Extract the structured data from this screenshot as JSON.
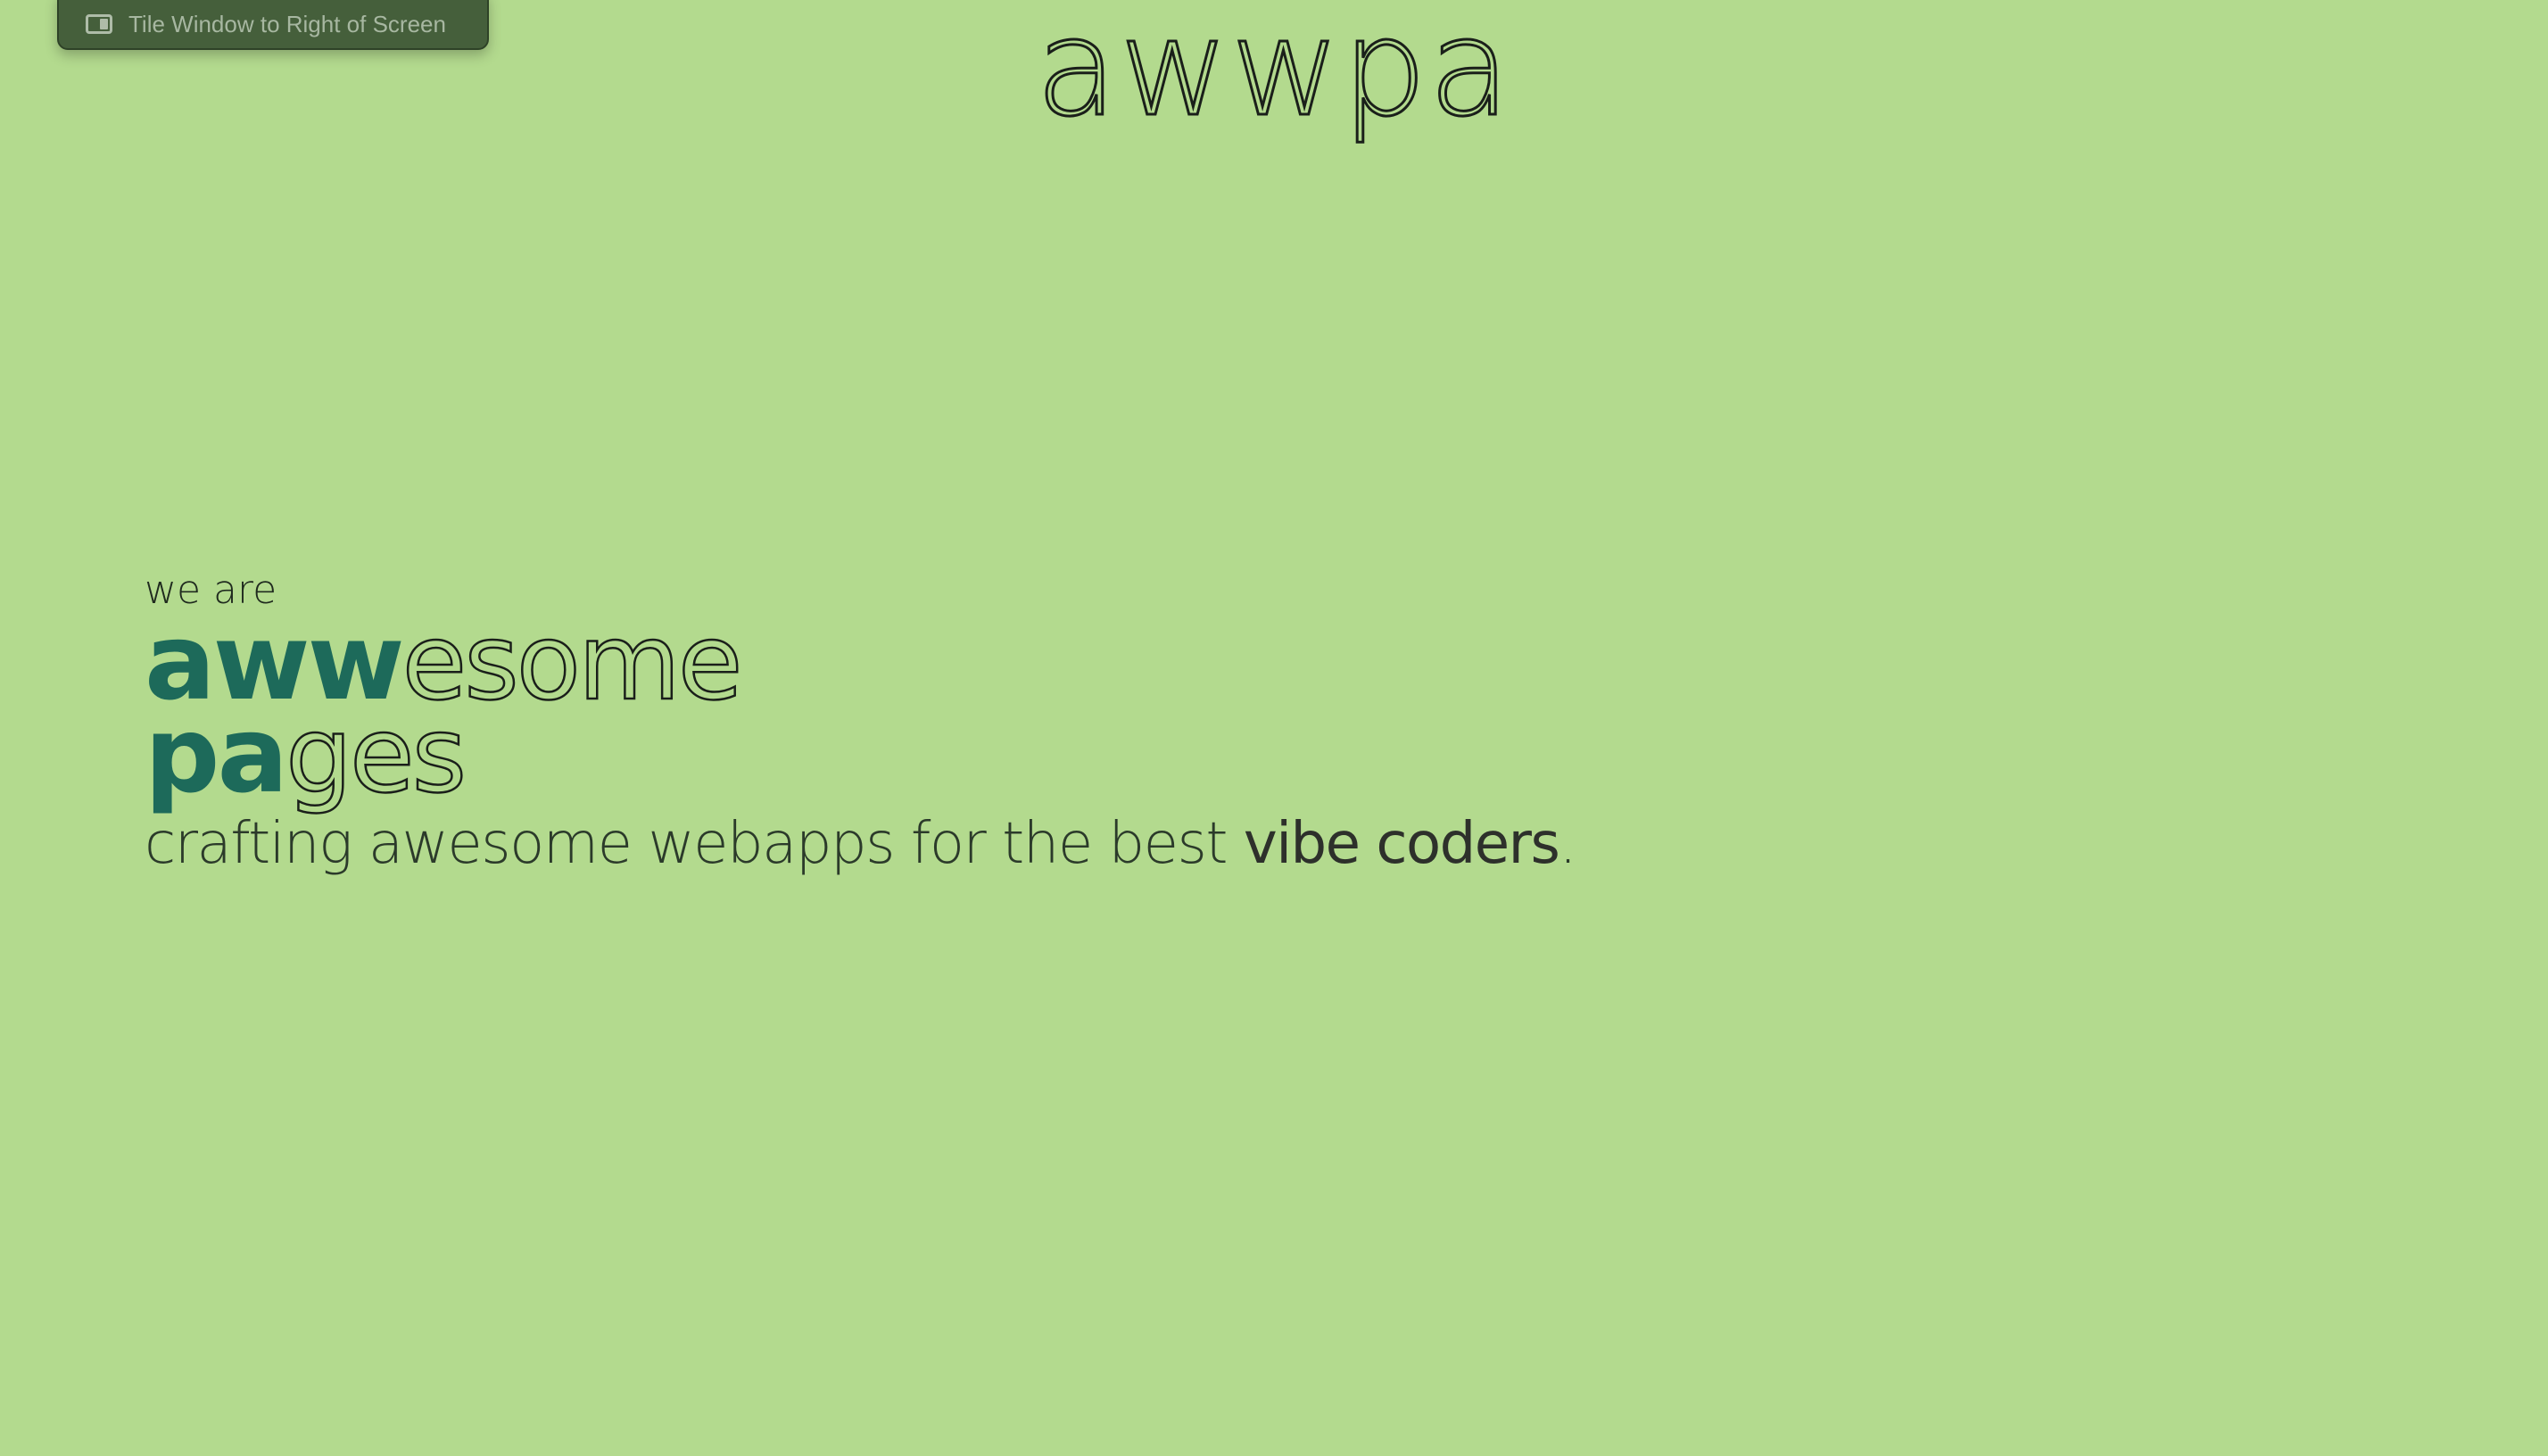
{
  "tooltip": {
    "icon": "tile-right-icon",
    "label": "Tile Window to Right of Screen"
  },
  "logo": {
    "text": "awwpa"
  },
  "hero": {
    "intro": "we are",
    "line1_accent": "aww",
    "line1_rest": "esome",
    "line2_accent": "pa",
    "line2_rest": "ges",
    "tagline_plain": "crafting awesome webapps for the best ",
    "tagline_emphasis": "vibe coders",
    "tagline_end": "."
  },
  "colors": {
    "background": "#b3da8e",
    "accent": "#1d6a5a",
    "text": "#1a1f1a",
    "tooltip_bg": "#455f3b"
  }
}
